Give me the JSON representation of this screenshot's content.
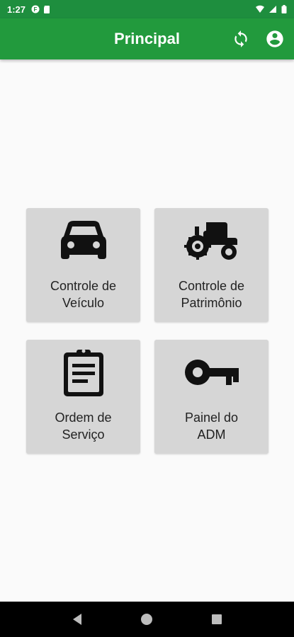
{
  "status_bar": {
    "time": "1:27",
    "left_icons": [
      "notification-f-icon",
      "sd-card-icon"
    ],
    "right_icons": [
      "wifi-icon",
      "signal-icon",
      "battery-icon"
    ]
  },
  "app_bar": {
    "title": "Principal",
    "actions": [
      "sync-icon",
      "account-circle-icon"
    ],
    "color": "#229a3d"
  },
  "tiles": [
    {
      "icon": "car-icon",
      "label_line1": "Controle de",
      "label_line2": "Veículo"
    },
    {
      "icon": "tractor-icon",
      "label_line1": "Controle de",
      "label_line2": "Patrimônio"
    },
    {
      "icon": "clipboard-icon",
      "label_line1": "Ordem de",
      "label_line2": "Serviço"
    },
    {
      "icon": "key-icon",
      "label_line1": "Painel do",
      "label_line2": "ADM"
    }
  ],
  "nav_bar": {
    "buttons": [
      "back-icon",
      "home-icon",
      "recents-icon"
    ]
  }
}
